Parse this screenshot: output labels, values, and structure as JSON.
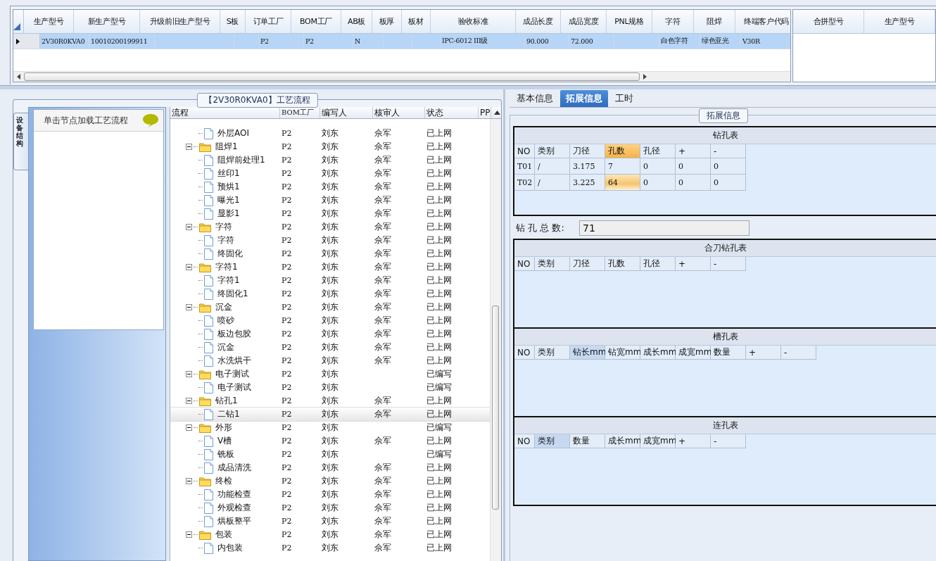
{
  "main_grid": {
    "columns": [
      "生产型号",
      "新生产型号",
      "升级前旧生产型号",
      "S板",
      "订单工厂",
      "BOM工厂",
      "AB板",
      "板厚",
      "板材",
      "验收标准",
      "成品长度",
      "成品宽度",
      "PNL规格",
      "字符",
      "阻焊",
      "终端客户代码"
    ],
    "rows": [
      {
        "selected": true,
        "cells": [
          "2V30R0KVA0",
          "10010200199911",
          null,
          null,
          "P2",
          "P2",
          "N",
          null,
          null,
          "IPC-6012 III级",
          "90.000",
          "72.000",
          null,
          "白色字符",
          "绿色亚光",
          "V30R"
        ]
      }
    ]
  },
  "side_grid": {
    "columns": [
      "合拼型号",
      "生产型号"
    ]
  },
  "process_panel": {
    "title": "【2V30R0KVA0】工艺流程",
    "side_tab": "设备结构",
    "hint": "单击节点加载工艺流程",
    "columns": [
      "流程",
      "BOM工厂",
      "编写人",
      "核审人",
      "状态",
      "PP"
    ],
    "tree": [
      {
        "kind": "file",
        "label": "外层AOI",
        "bom": "P2",
        "author": "刘东",
        "reviewer": "佘军",
        "status": "已上网",
        "selected": false
      },
      {
        "kind": "folder",
        "label": "阻焊1",
        "bom": "P2",
        "author": "刘东",
        "reviewer": "佘军",
        "status": "已上网",
        "selected": false,
        "expanded": true,
        "children": [
          {
            "kind": "file",
            "label": "阻焊前处理1",
            "bom": "P2",
            "author": "刘东",
            "reviewer": "佘军",
            "status": "已上网",
            "selected": false
          },
          {
            "kind": "file",
            "label": "丝印1",
            "bom": "P2",
            "author": "刘东",
            "reviewer": "佘军",
            "status": "已上网",
            "selected": false
          },
          {
            "kind": "file",
            "label": "预烘1",
            "bom": "P2",
            "author": "刘东",
            "reviewer": "佘军",
            "status": "已上网",
            "selected": false
          },
          {
            "kind": "file",
            "label": "曝光1",
            "bom": "P2",
            "author": "刘东",
            "reviewer": "佘军",
            "status": "已上网",
            "selected": false
          },
          {
            "kind": "file",
            "label": "显影1",
            "bom": "P2",
            "author": "刘东",
            "reviewer": "佘军",
            "status": "已上网",
            "selected": false
          }
        ]
      },
      {
        "kind": "folder",
        "label": "字符",
        "bom": "P2",
        "author": "刘东",
        "reviewer": "佘军",
        "status": "已上网",
        "selected": false,
        "expanded": true,
        "children": [
          {
            "kind": "file",
            "label": "字符",
            "bom": "P2",
            "author": "刘东",
            "reviewer": "佘军",
            "status": "已上网",
            "selected": false
          },
          {
            "kind": "file",
            "label": "终固化",
            "bom": "P2",
            "author": "刘东",
            "reviewer": "佘军",
            "status": "已上网",
            "selected": false
          }
        ]
      },
      {
        "kind": "folder",
        "label": "字符1",
        "bom": "P2",
        "author": "刘东",
        "reviewer": "佘军",
        "status": "已上网",
        "selected": false,
        "expanded": true,
        "children": [
          {
            "kind": "file",
            "label": "字符1",
            "bom": "P2",
            "author": "刘东",
            "reviewer": "佘军",
            "status": "已上网",
            "selected": false
          },
          {
            "kind": "file",
            "label": "终固化1",
            "bom": "P2",
            "author": "刘东",
            "reviewer": "佘军",
            "status": "已上网",
            "selected": false
          }
        ]
      },
      {
        "kind": "folder",
        "label": "沉金",
        "bom": "P2",
        "author": "刘东",
        "reviewer": "佘军",
        "status": "已上网",
        "selected": false,
        "expanded": true,
        "children": [
          {
            "kind": "file",
            "label": "喷砂",
            "bom": "P2",
            "author": "刘东",
            "reviewer": "佘军",
            "status": "已上网",
            "selected": false
          },
          {
            "kind": "file",
            "label": "板边包胶",
            "bom": "P2",
            "author": "刘东",
            "reviewer": "佘军",
            "status": "已上网",
            "selected": false
          },
          {
            "kind": "file",
            "label": "沉金",
            "bom": "P2",
            "author": "刘东",
            "reviewer": "佘军",
            "status": "已上网",
            "selected": false
          },
          {
            "kind": "file",
            "label": "水洗烘干",
            "bom": "P2",
            "author": "刘东",
            "reviewer": "佘军",
            "status": "已上网",
            "selected": false
          }
        ]
      },
      {
        "kind": "folder",
        "label": "电子测试",
        "bom": "P2",
        "author": "刘东",
        "status": "已编写",
        "selected": false,
        "expanded": true,
        "children": [
          {
            "kind": "file",
            "label": "电子测试",
            "bom": "P2",
            "author": "刘东",
            "status": "已编写",
            "selected": false
          }
        ]
      },
      {
        "kind": "folder",
        "label": "钻孔1",
        "bom": "P2",
        "author": "刘东",
        "reviewer": "佘军",
        "status": "已上网",
        "selected": false,
        "expanded": true,
        "children": [
          {
            "kind": "file",
            "label": "二钻1",
            "bom": "P2",
            "author": "刘东",
            "reviewer": "佘军",
            "status": "已上网",
            "selected": true
          }
        ]
      },
      {
        "kind": "folder",
        "label": "外形",
        "bom": "P2",
        "author": "刘东",
        "status": "已编写",
        "selected": false,
        "expanded": true,
        "children": [
          {
            "kind": "file",
            "label": "V槽",
            "bom": "P2",
            "author": "刘东",
            "reviewer": "佘军",
            "status": "已上网",
            "selected": false
          },
          {
            "kind": "file",
            "label": "铣板",
            "bom": "P2",
            "author": "刘东",
            "status": "已编写",
            "selected": false
          },
          {
            "kind": "file",
            "label": "成品清洗",
            "bom": "P2",
            "author": "刘东",
            "reviewer": "佘军",
            "status": "已上网",
            "selected": false
          }
        ]
      },
      {
        "kind": "folder",
        "label": "终检",
        "bom": "P2",
        "author": "刘东",
        "reviewer": "佘军",
        "status": "已上网",
        "selected": false,
        "expanded": true,
        "children": [
          {
            "kind": "file",
            "label": "功能检查",
            "bom": "P2",
            "author": "刘东",
            "reviewer": "佘军",
            "status": "已上网",
            "selected": false
          },
          {
            "kind": "file",
            "label": "外观检查",
            "bom": "P2",
            "author": "刘东",
            "reviewer": "佘军",
            "status": "已上网",
            "selected": false
          },
          {
            "kind": "file",
            "label": "烘板整平",
            "bom": "P2",
            "author": "刘东",
            "reviewer": "佘军",
            "status": "已上网",
            "selected": false
          }
        ]
      },
      {
        "kind": "folder",
        "label": "包装",
        "bom": "P2",
        "author": "刘东",
        "reviewer": "佘军",
        "status": "已上网",
        "selected": false,
        "expanded": true,
        "children": [
          {
            "kind": "file",
            "label": "内包装",
            "bom": "P2",
            "author": "刘东",
            "reviewer": "佘军",
            "status": "已上网",
            "selected": false
          }
        ]
      }
    ]
  },
  "detail_panel": {
    "tabs": [
      {
        "label": "基本信息",
        "selected": false
      },
      {
        "label": "拓展信息",
        "selected": true
      },
      {
        "label": "工时",
        "selected": false
      }
    ],
    "group_title": "拓展信息",
    "sections": [
      {
        "kind": "table",
        "title": "钻孔表",
        "columns": [
          {
            "label": "NO",
            "highlighted": false
          },
          {
            "label": "类别",
            "highlighted": false
          },
          {
            "label": "刀径",
            "highlighted": false
          },
          {
            "label": "孔数",
            "highlighted": true
          },
          {
            "label": "孔径",
            "highlighted": false
          },
          {
            "label": "+",
            "highlighted": false
          },
          {
            "label": "-",
            "highlighted": false
          }
        ],
        "rows": [
          {
            "selected": false,
            "cells": [
              "T01",
              "/",
              "3.175",
              "7",
              "0",
              "0",
              "0"
            ]
          },
          {
            "selected": true,
            "cells": [
              "T02",
              "/",
              "3.225",
              "64",
              "0",
              "0",
              "0"
            ]
          }
        ]
      },
      {
        "kind": "total",
        "label": "钻 孔 总 数:",
        "value": "71"
      },
      {
        "kind": "table",
        "title": "合刀钻孔表",
        "columns": [
          {
            "label": "NO",
            "highlighted": false
          },
          {
            "label": "类别",
            "highlighted": false
          },
          {
            "label": "刀径",
            "highlighted": false
          },
          {
            "label": "孔数",
            "highlighted": false
          },
          {
            "label": "孔径",
            "highlighted": false
          },
          {
            "label": "+",
            "highlighted": false
          },
          {
            "label": "-",
            "highlighted": false
          }
        ]
      },
      {
        "kind": "table",
        "title": "槽孔表",
        "columns": [
          {
            "label": "NO",
            "highlighted": false
          },
          {
            "label": "类别",
            "highlighted": false
          },
          {
            "label": "钻长mm",
            "highlighted": true
          },
          {
            "label": "钻宽mm",
            "highlighted": false
          },
          {
            "label": "成长mm",
            "highlighted": false
          },
          {
            "label": "成宽mm",
            "highlighted": false
          },
          {
            "label": "数量",
            "highlighted": false
          },
          {
            "label": "+",
            "highlighted": false
          },
          {
            "label": "-",
            "highlighted": false
          }
        ]
      },
      {
        "kind": "table",
        "title": "连孔表",
        "columns": [
          {
            "label": "NO",
            "highlighted": false
          },
          {
            "label": "类别",
            "highlighted": true
          },
          {
            "label": "数量",
            "highlighted": false
          },
          {
            "label": "成长mm",
            "highlighted": false
          },
          {
            "label": "成宽mm",
            "highlighted": false
          },
          {
            "label": "+",
            "highlighted": false
          },
          {
            "label": "-",
            "highlighted": false
          }
        ]
      }
    ]
  }
}
